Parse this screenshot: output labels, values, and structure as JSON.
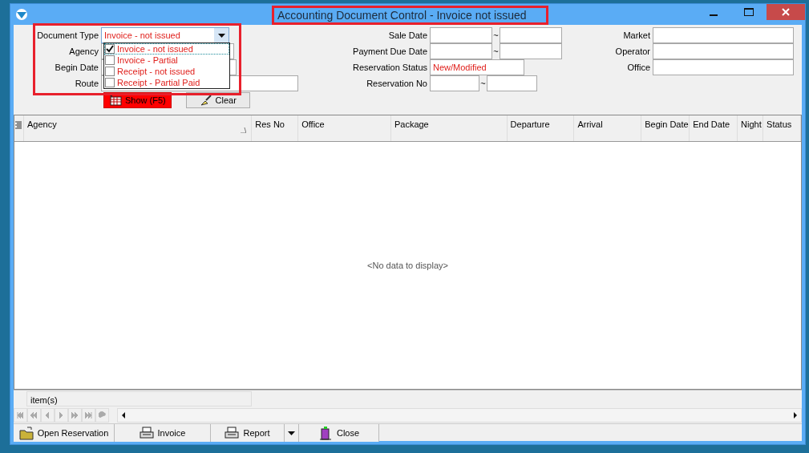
{
  "window": {
    "title": "Accounting Document Control - Invoice not issued"
  },
  "filters": {
    "left": [
      {
        "label": "Document Type",
        "kind": "combo",
        "value": "Invoice - not issued"
      },
      {
        "label": "Agency",
        "kind": "text"
      },
      {
        "label": "Begin Date",
        "kind": "range"
      },
      {
        "label": "Route",
        "kind": "wide"
      }
    ],
    "middle": [
      {
        "label": "Sale Date",
        "kind": "range",
        "separator": "~"
      },
      {
        "label": "Payment Due Date",
        "kind": "range",
        "separator": "~"
      },
      {
        "label": "Reservation Status",
        "kind": "text",
        "value": "New/Modified"
      },
      {
        "label": "Reservation No",
        "kind": "short_range",
        "separator": "~"
      }
    ],
    "right": [
      {
        "label": "Market",
        "kind": "text"
      },
      {
        "label": "Operator",
        "kind": "text"
      },
      {
        "label": "Office",
        "kind": "text"
      }
    ]
  },
  "dropdown": {
    "options": [
      {
        "label": "Invoice - not issued",
        "checked": true,
        "selected": true
      },
      {
        "label": "Invoice - Partial",
        "checked": false,
        "selected": false
      },
      {
        "label": "Receipt - not issued",
        "checked": false,
        "selected": false
      },
      {
        "label": "Receipt - Partial Paid",
        "checked": false,
        "selected": false
      }
    ]
  },
  "actions": [
    {
      "label": "Show (F5)",
      "kind": "primary"
    },
    {
      "label": "Clear",
      "kind": "clear"
    }
  ],
  "table": {
    "columns": [
      {
        "label": "Agency",
        "sorted": true
      },
      {
        "label": "Res No",
        "sorted": false
      },
      {
        "label": "Office",
        "sorted": false
      },
      {
        "label": "Package",
        "sorted": false
      },
      {
        "label": "Departure",
        "sorted": false
      },
      {
        "label": "Arrival",
        "sorted": false
      },
      {
        "label": "Begin Date",
        "sorted": false
      },
      {
        "label": "End Date",
        "sorted": false
      },
      {
        "label": "Night",
        "sorted": false
      },
      {
        "label": "Status",
        "sorted": false
      }
    ],
    "empty_message": "<No data to display>",
    "footer": "item(s)"
  },
  "buttons": [
    {
      "label": "Open Reservation",
      "kind": "folder"
    },
    {
      "label": "Invoice",
      "kind": "printer"
    },
    {
      "label": "Report",
      "kind": "printer",
      "menu": true
    },
    {
      "label": "Close",
      "kind": "exit"
    }
  ]
}
